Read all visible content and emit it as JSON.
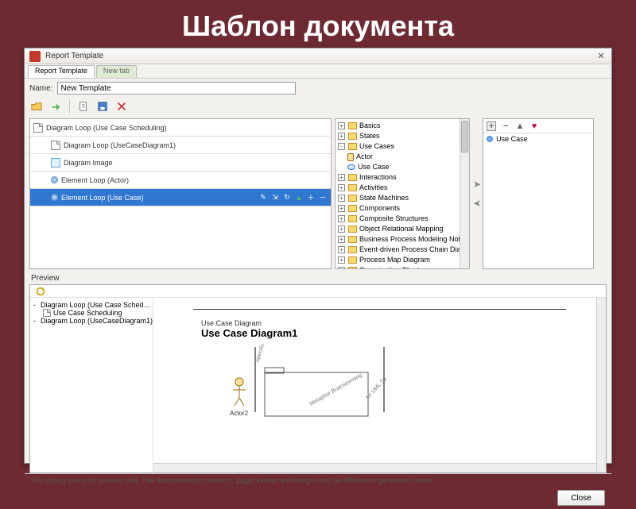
{
  "slide": {
    "title": "Шаблон документа"
  },
  "window": {
    "title": "Report Template",
    "tabs": [
      "Report Template",
      "New tab"
    ],
    "name_label": "Name:",
    "name_value": "New Template",
    "close_label": "Close",
    "status": "This dialog box is for preview only. The documentation contents, page number and margin may be different in generated report."
  },
  "loop_rows": [
    {
      "label": "Diagram Loop (Use Case Scheduling)",
      "icon": "doc",
      "indent": 0
    },
    {
      "label": "Diagram Loop (UseCaseDiagram1)",
      "icon": "doc",
      "indent": 1
    },
    {
      "label": "Diagram Image",
      "icon": "img",
      "indent": 1
    },
    {
      "label": "Element Loop (Actor)",
      "icon": "ball",
      "indent": 1
    },
    {
      "label": "Element Loop (Use Case)",
      "icon": "ball",
      "indent": 1,
      "selected": true
    }
  ],
  "tree": [
    {
      "label": "Basics",
      "type": "fld",
      "pm": "+",
      "ind": 0
    },
    {
      "label": "States",
      "type": "fld",
      "pm": "+",
      "ind": 0
    },
    {
      "label": "Use Cases",
      "type": "fld",
      "pm": "-",
      "ind": 0
    },
    {
      "label": "Actor",
      "type": "actor",
      "ind": 1
    },
    {
      "label": "Use Case",
      "type": "uc",
      "ind": 1
    },
    {
      "label": "Interactions",
      "type": "fld",
      "pm": "+",
      "ind": 0
    },
    {
      "label": "Activities",
      "type": "fld",
      "pm": "+",
      "ind": 0
    },
    {
      "label": "State Machines",
      "type": "fld",
      "pm": "+",
      "ind": 0
    },
    {
      "label": "Components",
      "type": "fld",
      "pm": "+",
      "ind": 0
    },
    {
      "label": "Composite Structures",
      "type": "fld",
      "pm": "+",
      "ind": 0
    },
    {
      "label": "Object Relational Mapping",
      "type": "fld",
      "pm": "+",
      "ind": 0
    },
    {
      "label": "Business Process Modeling Notat",
      "type": "fld",
      "pm": "+",
      "ind": 0
    },
    {
      "label": "Event-driven Process Chain Diag",
      "type": "fld",
      "pm": "+",
      "ind": 0
    },
    {
      "label": "Process Map Diagram",
      "type": "fld",
      "pm": "+",
      "ind": 0
    },
    {
      "label": "Organization Chart",
      "type": "fld",
      "pm": "+",
      "ind": 0
    }
  ],
  "right_items": [
    {
      "label": "Use Case",
      "icon": "ball"
    }
  ],
  "preview": {
    "label": "Preview",
    "tree": [
      {
        "label": "Diagram Loop (Use Case Sched…",
        "pm": "-",
        "ind": 0,
        "fld": true
      },
      {
        "label": "Use Case Scheduling",
        "ind": 1,
        "fld": false
      },
      {
        "label": "Diagram Loop (UseCaseDiagram1)",
        "pm": "-",
        "ind": 0,
        "fld": true
      }
    ],
    "doc": {
      "kicker": "Use Case Diagram",
      "title": "Use Case Diagram1",
      "actor": "Actor2"
    }
  }
}
